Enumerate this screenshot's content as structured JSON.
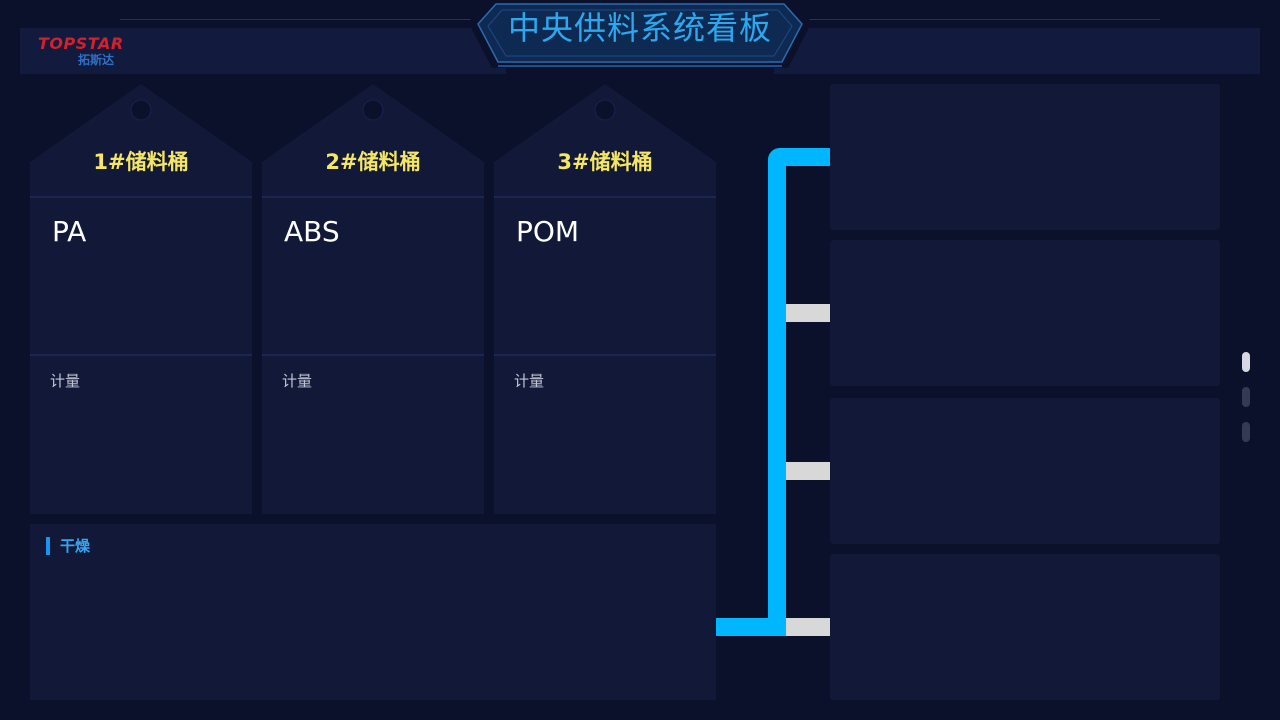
{
  "header": {
    "title": "中央供料系统看板",
    "logo_en": "TOPSTAR",
    "logo_cn": "拓斯达"
  },
  "tanks": [
    {
      "title": "1#储料桶",
      "material": "PA",
      "metric_label": "计量"
    },
    {
      "title": "2#储料桶",
      "material": "ABS",
      "metric_label": "计量"
    },
    {
      "title": "3#储料桶",
      "material": "POM",
      "metric_label": "计量"
    }
  ],
  "dryer": {
    "label": "干燥"
  },
  "stations": [
    {},
    {},
    {},
    {}
  ],
  "pagination": {
    "pages": 3,
    "active_page": 1
  },
  "colors": {
    "background": "#0c112b",
    "panel": "#111838",
    "title_blue": "#2aa9f0",
    "tank_title_yellow": "#f5e663",
    "pipe_cyan": "#00b7ff",
    "valve_gray": "#d8d8d8",
    "logo_red": "#d3202a"
  }
}
